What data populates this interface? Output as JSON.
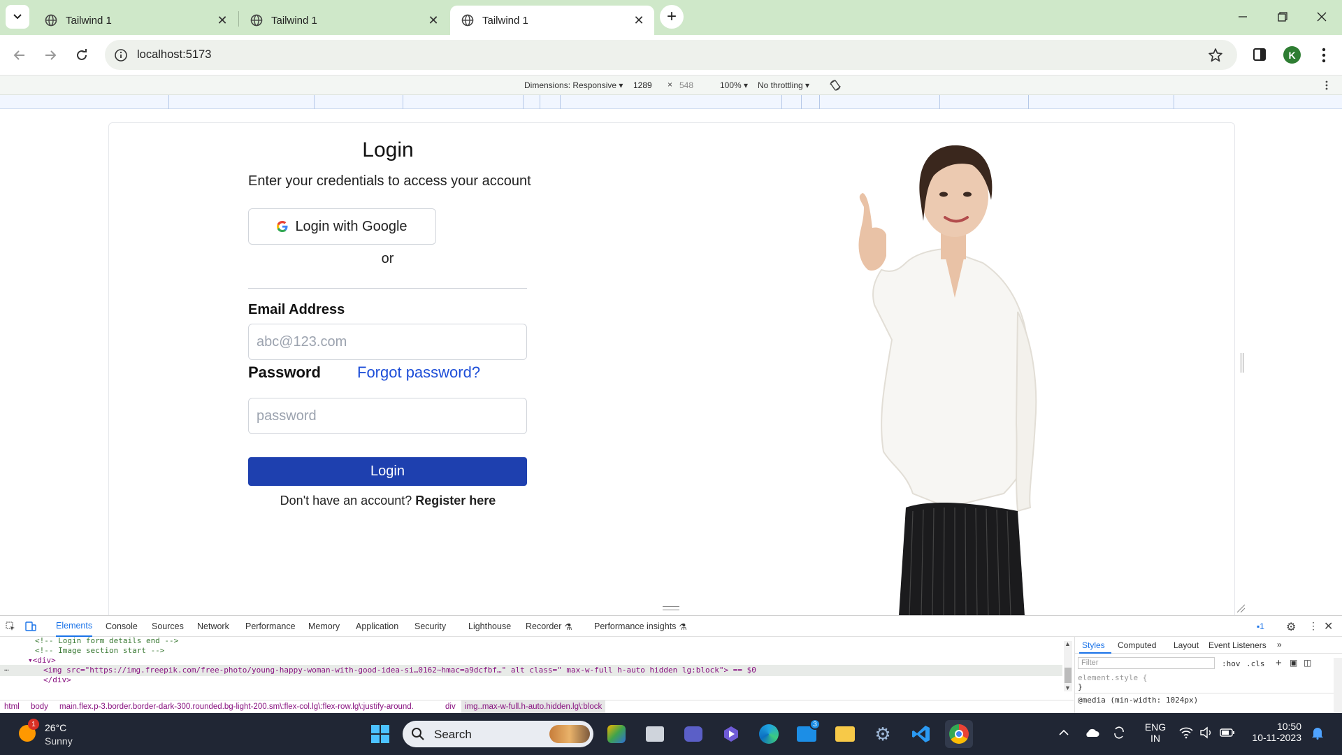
{
  "browser": {
    "tabs": [
      {
        "title": "Tailwind 1",
        "active": false
      },
      {
        "title": "Tailwind 1",
        "active": false
      },
      {
        "title": "Tailwind 1",
        "active": true
      }
    ],
    "url": "localhost:5173",
    "profile_initial": "K"
  },
  "device_toolbar": {
    "dimensions_label": "Dimensions: Responsive",
    "width": "1289",
    "height": "548",
    "zoom": "100%",
    "throttling": "No throttling"
  },
  "login": {
    "title": "Login",
    "subtitle": "Enter your credentials to access your account",
    "google_button": "Login with Google",
    "divider_text": "or",
    "email_label": "Email Address",
    "email_placeholder": "abc@123.com",
    "password_label": "Password",
    "forgot_link": "Forgot password?",
    "password_placeholder": "password",
    "submit_button": "Login",
    "register_prompt": "Don't have an account?",
    "register_link": "Register here"
  },
  "devtools": {
    "tabs": [
      "Elements",
      "Console",
      "Sources",
      "Network",
      "Performance",
      "Memory",
      "Application",
      "Security",
      "Lighthouse",
      "Recorder",
      "Performance insights"
    ],
    "active_tab": "Elements",
    "issues_count": "1",
    "code_lines": [
      "<!-- Login form details end -->",
      "<!-- Image section start -->",
      "<div>",
      "<img src=\"https://img.freepik.com/free-photo/young-happy-woman-with-good-idea-si…0162~hmac=a9dcfbf…\" alt class=\" max-w-full h-auto hidden lg:block\"> == $0",
      "</div>"
    ],
    "breadcrumb": [
      "html",
      "body",
      "main.flex.p-3.border.border-dark-300.rounded.bg-light-200.sm\\:flex-col.lg\\:flex-row.lg\\:justify-around.",
      "div",
      "img..max-w-full.h-auto.hidden.lg\\:block"
    ],
    "styles_tabs": [
      "Styles",
      "Computed",
      "Layout",
      "Event Listeners"
    ],
    "filter_placeholder": "Filter",
    "hov": ":hov",
    "cls": ".cls",
    "element_style": "element.style {",
    "element_style_close": "}",
    "media_query": "@media (min-width: 1024px)"
  },
  "taskbar": {
    "weather_temp": "26°C",
    "weather_desc": "Sunny",
    "weather_badge": "1",
    "search_label": "Search",
    "mail_badge": "3",
    "lang_line1": "ENG",
    "lang_line2": "IN",
    "time": "10:50",
    "date": "10-11-2023"
  },
  "colors": {
    "tabstrip": "#cfe8c9",
    "accent_blue": "#1e40af",
    "link_blue": "#1d4ed8",
    "taskbar": "#202634"
  }
}
